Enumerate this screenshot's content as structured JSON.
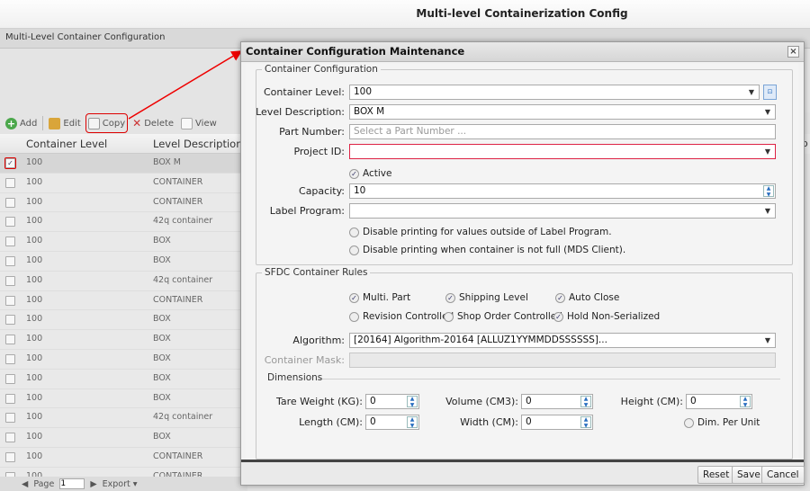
{
  "app": {
    "title": "Multi-level Containerization Config"
  },
  "panel": {
    "title": "Multi-Level Container Configuration"
  },
  "toolbar": {
    "add": "Add",
    "edit": "Edit",
    "copy": "Copy",
    "delete": "Delete",
    "view": "View"
  },
  "grid": {
    "columns": [
      "Container Level",
      "Level Description"
    ],
    "right_header": "op",
    "rows": [
      {
        "level": "100",
        "desc": "BOX M",
        "checked": true
      },
      {
        "level": "100",
        "desc": "CONTAINER"
      },
      {
        "level": "100",
        "desc": "CONTAINER"
      },
      {
        "level": "100",
        "desc": "42q container"
      },
      {
        "level": "100",
        "desc": "BOX"
      },
      {
        "level": "100",
        "desc": "BOX"
      },
      {
        "level": "100",
        "desc": "42q container"
      },
      {
        "level": "100",
        "desc": "CONTAINER"
      },
      {
        "level": "100",
        "desc": "BOX"
      },
      {
        "level": "100",
        "desc": "BOX"
      },
      {
        "level": "100",
        "desc": "BOX"
      },
      {
        "level": "100",
        "desc": "BOX"
      },
      {
        "level": "100",
        "desc": "BOX"
      },
      {
        "level": "100",
        "desc": "42q container"
      },
      {
        "level": "100",
        "desc": "BOX"
      },
      {
        "level": "100",
        "desc": "CONTAINER"
      },
      {
        "level": "100",
        "desc": "CONTAINER"
      }
    ]
  },
  "pager": {
    "page_label": "Page",
    "page_value": "1",
    "export": "Export"
  },
  "dialog": {
    "title": "Container Configuration Maintenance",
    "close": "×",
    "section1": {
      "legend": "Container Configuration",
      "level_label": "Container Level:",
      "level_value": "100",
      "desc_label": "Level Description:",
      "desc_value": "BOX M",
      "part_label": "Part Number:",
      "part_placeholder": "Select a Part Number ...",
      "project_label": "Project ID:",
      "project_value": "",
      "active_label": "Active",
      "capacity_label": "Capacity:",
      "capacity_value": "10",
      "label_program_label": "Label Program:",
      "label_program_value": "",
      "disable1": "Disable printing for values outside of Label Program.",
      "disable2": "Disable printing when container is not full (MDS Client)."
    },
    "section2": {
      "legend": "SFDC Container Rules",
      "multi_part": "Multi. Part",
      "shipping_level": "Shipping Level",
      "auto_close": "Auto Close",
      "revision_controlled": "Revision Controlled",
      "shop_order_controlled": "Shop Order Controlled",
      "hold_non_serialized": "Hold Non-Serialized",
      "algorithm_label": "Algorithm:",
      "algorithm_value": "[20164] Algorithm-20164 [ALLUZ1YYMMDDSSSSSS]...",
      "mask_label": "Container Mask:",
      "mask_value": "",
      "dimensions_legend": "Dimensions",
      "tare_label": "Tare Weight (KG):",
      "tare_value": "0",
      "volume_label": "Volume (CM3):",
      "volume_value": "0",
      "height_label": "Height (CM):",
      "height_value": "0",
      "length_label": "Length (CM):",
      "length_value": "0",
      "width_label": "Width (CM):",
      "width_value": "0",
      "dim_per_unit": "Dim. Per Unit"
    },
    "buttons": {
      "reset": "Reset",
      "save": "Save",
      "cancel": "Cancel"
    }
  },
  "colors": {
    "highlight": "#dd0000",
    "error_border": "#d22244"
  }
}
